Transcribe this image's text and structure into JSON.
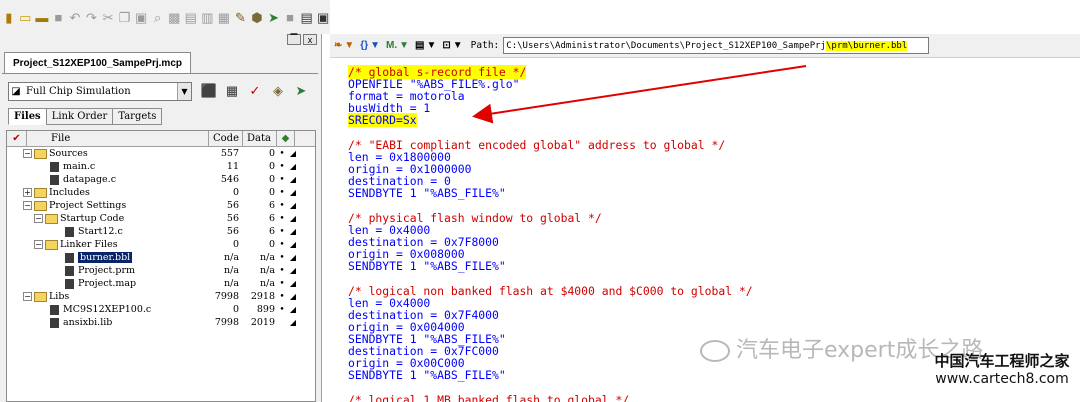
{
  "toolbar": {
    "icons": [
      "new-icon",
      "open-icon",
      "save-icon",
      "save-all-icon",
      "undo-icon",
      "redo-icon",
      "cut-icon",
      "copy-icon",
      "paste-icon",
      "find-icon",
      "replace-icon",
      "indent-icon",
      "outdent-icon",
      "comment-icon",
      "settings-icon",
      "build-icon",
      "stop-icon",
      "list-icon",
      "window-icon"
    ]
  },
  "project": {
    "tab": "Project_S12XEP100_SampePrj.mcp",
    "target": "Full Chip Simulation",
    "subtabs": [
      "Files",
      "Link Order",
      "Targets"
    ],
    "columns": {
      "file": "File",
      "code": "Code",
      "data": "Data"
    },
    "rows": [
      {
        "name": "Sources",
        "code": "557",
        "data": "0",
        "bullet": "•"
      },
      {
        "name": "main.c",
        "code": "11",
        "data": "0",
        "bullet": "•"
      },
      {
        "name": "datapage.c",
        "code": "546",
        "data": "0",
        "bullet": "•"
      },
      {
        "name": "Includes",
        "code": "0",
        "data": "0",
        "bullet": "•"
      },
      {
        "name": "Project Settings",
        "code": "56",
        "data": "6",
        "bullet": "•"
      },
      {
        "name": "Startup Code",
        "code": "56",
        "data": "6",
        "bullet": "•"
      },
      {
        "name": "Start12.c",
        "code": "56",
        "data": "6",
        "bullet": "•"
      },
      {
        "name": "Linker Files",
        "code": "0",
        "data": "0",
        "bullet": "•"
      },
      {
        "name": "burner.bbl",
        "code": "n/a",
        "data": "n/a",
        "bullet": "•"
      },
      {
        "name": "Project.prm",
        "code": "n/a",
        "data": "n/a",
        "bullet": "•"
      },
      {
        "name": "Project.map",
        "code": "n/a",
        "data": "n/a",
        "bullet": "•"
      },
      {
        "name": "Libs",
        "code": "7998",
        "data": "2918",
        "bullet": "•"
      },
      {
        "name": "MC9S12XEP100.c",
        "code": "0",
        "data": "899",
        "bullet": "•"
      },
      {
        "name": "ansixbi.lib",
        "code": "7998",
        "data": "2019",
        "bullet": ""
      }
    ]
  },
  "editor_toolbar": {
    "path_label": "Path:",
    "path_main": "C:\\Users\\Administrator\\Documents\\Project_S12XEP100_SampePrj",
    "path_highlight": "\\prm\\burner.bbl"
  },
  "code": {
    "lines": [
      "/* global s-record file */",
      "OPENFILE \"%ABS_FILE%.glo\"",
      "format = motorola",
      "busWidth = 1",
      "SRECORD=Sx",
      "/* \"EABI compliant encoded global\" address to global */",
      "len = 0x1800000",
      "origin = 0x1000000",
      "destination = 0",
      "SENDBYTE 1 \"%ABS_FILE%\"",
      "/* physical flash window to global */",
      "len = 0x4000",
      "destination = 0x7F8000",
      "origin = 0x008000",
      "SENDBYTE 1 \"%ABS_FILE%\"",
      "/* logical non banked flash at $4000 and $C000 to global */",
      "len = 0x4000",
      "destination = 0x7F4000",
      "origin = 0x004000",
      "SENDBYTE 1 \"%ABS_FILE%\"",
      "destination = 0x7FC000",
      "origin = 0x00C000",
      "SENDBYTE 1 \"%ABS_FILE%\"",
      "/* logical 1 MB banked flash to global */"
    ]
  },
  "watermark": {
    "text": "汽车电子expert成长之路",
    "site_cn": "中国汽车工程师之家",
    "site_url": "www.cartech8.com"
  },
  "colors": {
    "comment": "#d00000",
    "code": "#0000ff",
    "highlight": "#ffff00",
    "arrow": "#e00000"
  }
}
